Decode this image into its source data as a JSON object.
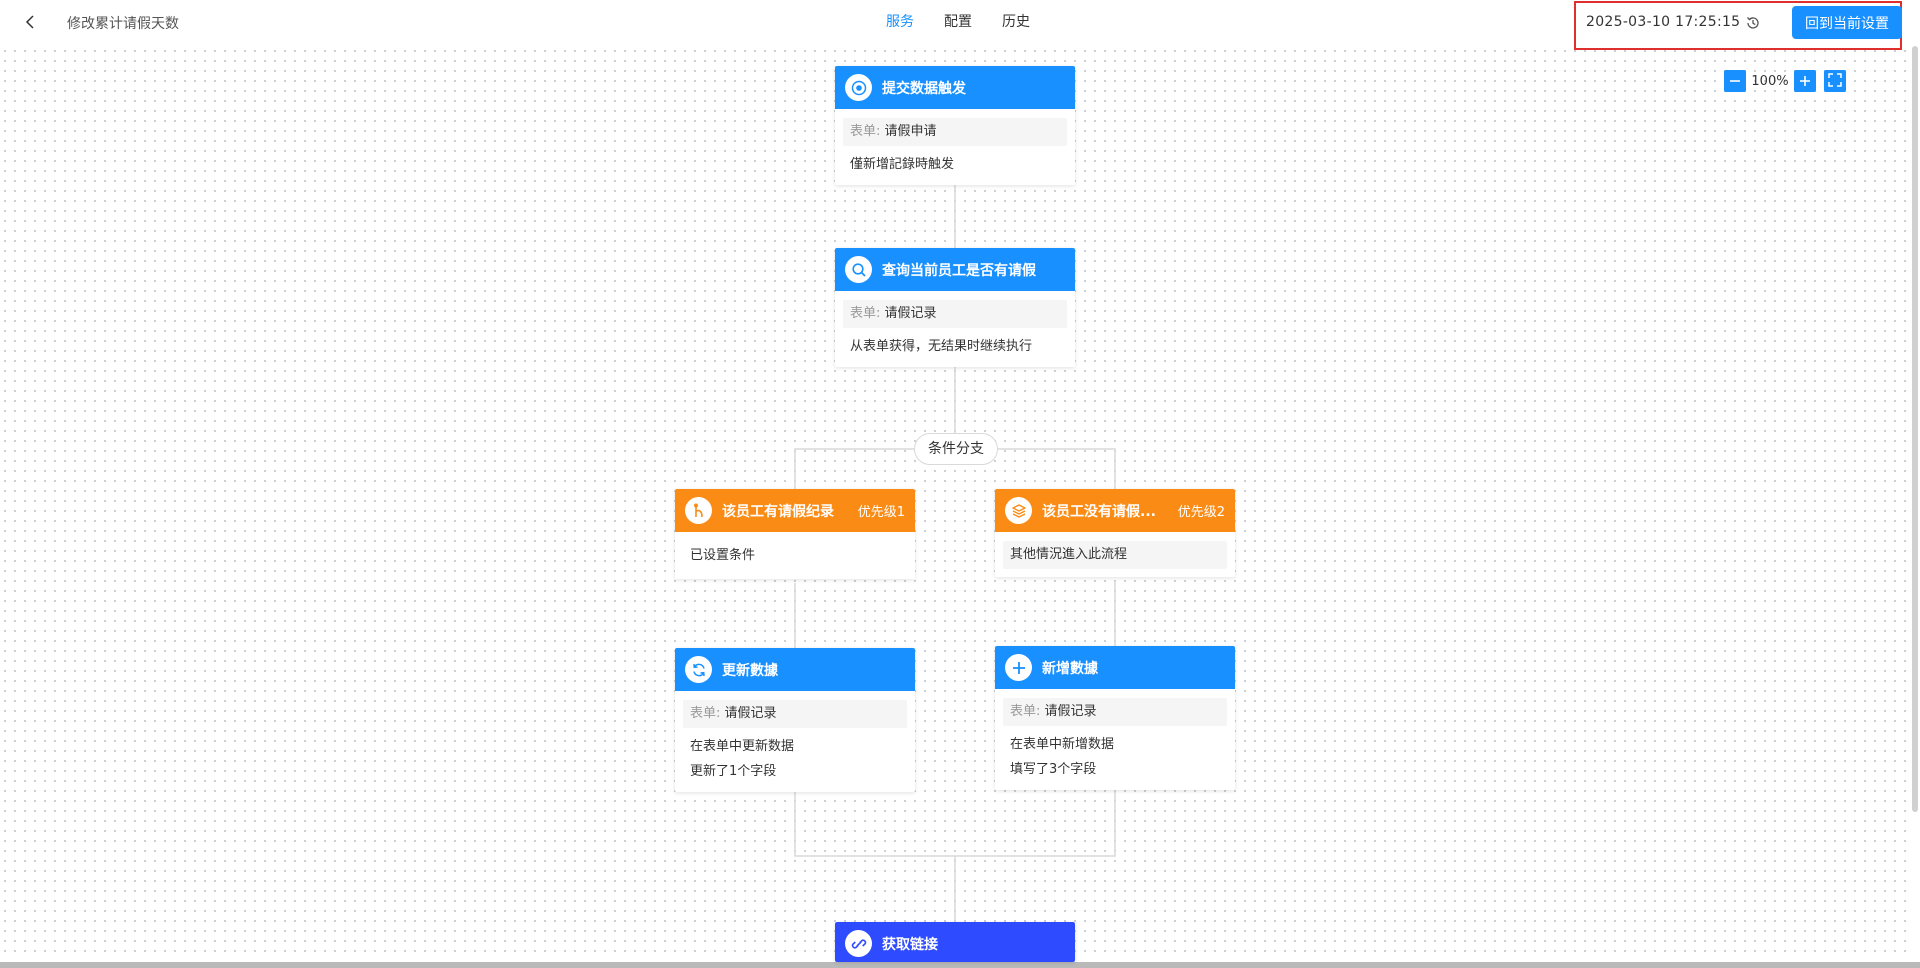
{
  "header": {
    "title": "修改累计请假天数",
    "tabs": [
      {
        "label": "服务",
        "active": true
      },
      {
        "label": "配置",
        "active": false
      },
      {
        "label": "历史",
        "active": false
      }
    ],
    "timestamp": "2025-03-10 17:25:15",
    "restore_button": "回到当前设置"
  },
  "zoom": {
    "level": "100%"
  },
  "colors": {
    "primary": "#1890ff",
    "branch": "#fa8c16",
    "link": "#2f4bff",
    "highlight": "#e0302e"
  },
  "nodes": {
    "trigger": {
      "title": "提交数据触发",
      "icon": "target-icon",
      "form_label": "表单:",
      "form_value": "请假申请",
      "desc": "僅新增記錄時触发"
    },
    "query": {
      "title": "查询当前员工是否有请假",
      "icon": "search-icon",
      "form_label": "表单:",
      "form_value": "请假记录",
      "desc": "从表单获得，无结果时继续执行"
    },
    "branch_label": "条件分支",
    "branch1": {
      "title": "该员工有请假纪录",
      "priority": "优先级1",
      "icon": "branch-icon",
      "desc": "已设置条件"
    },
    "branch2": {
      "title": "该员工没有请假...",
      "priority": "优先级2",
      "icon": "layers-icon",
      "desc": "其他情況進入此流程"
    },
    "update": {
      "title": "更新數據",
      "icon": "refresh-icon",
      "form_label": "表单:",
      "form_value": "请假记录",
      "line1": "在表单中更新数据",
      "line2": "更新了1个字段"
    },
    "add": {
      "title": "新增數據",
      "icon": "plus-circle-icon",
      "form_label": "表单:",
      "form_value": "请假记录",
      "line1": "在表单中新增数据",
      "line2": "填写了3个字段"
    },
    "link": {
      "title": "获取链接",
      "icon": "link-icon"
    }
  }
}
